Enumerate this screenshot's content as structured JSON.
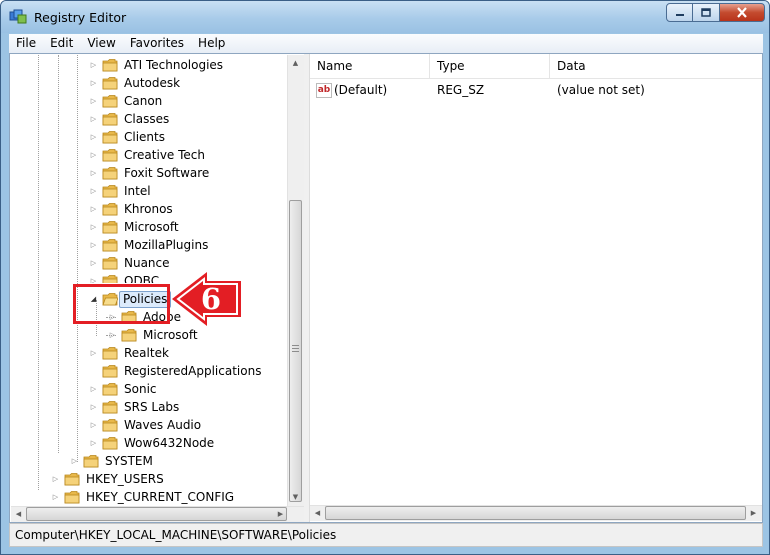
{
  "window": {
    "title": "Registry Editor",
    "minimize_icon": "minimize-icon",
    "maximize_icon": "maximize-icon",
    "close_icon": "close-icon"
  },
  "menu": [
    "File",
    "Edit",
    "View",
    "Favorites",
    "Help"
  ],
  "tree": {
    "software_children": [
      "ATI Technologies",
      "Autodesk",
      "Canon",
      "Classes",
      "Clients",
      "Creative Tech",
      "Foxit Software",
      "Intel",
      "Khronos",
      "Microsoft",
      "MozillaPlugins",
      "Nuance",
      "ODBC"
    ],
    "selected": "Policies",
    "policies_children": [
      "Adobe",
      "Microsoft"
    ],
    "after_policies": [
      "Realtek",
      "RegisteredApplications",
      "Sonic",
      "SRS Labs",
      "Waves Audio",
      "Wow6432Node"
    ],
    "hklm_more": [
      "SYSTEM"
    ],
    "roots": [
      "HKEY_USERS",
      "HKEY_CURRENT_CONFIG"
    ]
  },
  "list": {
    "columns": [
      "Name",
      "Type",
      "Data"
    ],
    "rows": [
      {
        "name": "(Default)",
        "type": "REG_SZ",
        "data": "(value not set)",
        "icon": "ab"
      }
    ]
  },
  "status": "Computer\\HKEY_LOCAL_MACHINE\\SOFTWARE\\Policies",
  "annotation": {
    "step_number": "6",
    "color": "#e31e24"
  }
}
